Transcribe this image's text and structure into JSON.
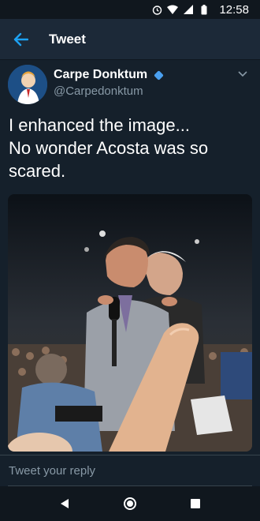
{
  "status_bar": {
    "time": "12:58",
    "icons": [
      "alarm-icon",
      "wifi-icon",
      "signal-icon",
      "battery-icon"
    ]
  },
  "app_bar": {
    "back_icon": "arrow-left-icon",
    "title": "Tweet"
  },
  "tweet": {
    "display_name": "Carpe Donktum",
    "verified": true,
    "handle": "@Carpedonktum",
    "text_line1": "I enhanced the image...",
    "text_line2": "No wonder Acosta was so",
    "text_line3": "scared.",
    "media_icon": "photo"
  },
  "reply": {
    "placeholder": "Tweet your reply"
  },
  "nav_bar": {
    "icons": [
      "back-triangle-icon",
      "home-circle-icon",
      "recents-square-icon"
    ]
  },
  "colors": {
    "background": "#15202b",
    "app_bar": "#1c2938",
    "accent": "#1da1f2",
    "secondary_text": "#8899a6"
  }
}
